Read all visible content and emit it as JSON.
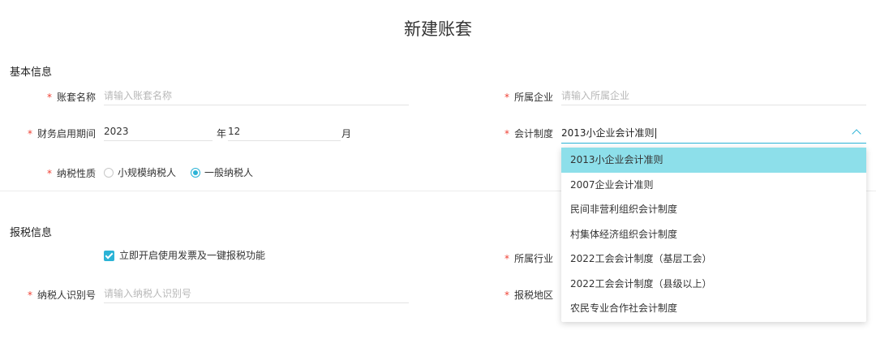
{
  "title": "新建账套",
  "basic": {
    "section": "基本信息",
    "name_label": "账套名称",
    "name_placeholder": "请输入账套名称",
    "company_label": "所属企业",
    "company_placeholder": "请输入所属企业",
    "period_label": "财务启用期间",
    "year_value": "2023",
    "year_unit": "年",
    "month_value": "12",
    "month_unit": "月",
    "accounting_label": "会计制度",
    "accounting_value": "2013小企业会计准则",
    "tax_label": "纳税性质",
    "tax_options": [
      "小规模纳税人",
      "一般纳税人"
    ]
  },
  "tax_report": {
    "section": "报税信息",
    "enable_label": "立即开启使用发票及一键报税功能",
    "industry_label": "所属行业",
    "taxpayer_id_label": "纳税人识别号",
    "taxpayer_id_placeholder": "请输入纳税人识别号",
    "region_label": "报税地区"
  },
  "required_mark": "*",
  "dropdown_options": [
    "2013小企业会计准则",
    "2007企业会计准则",
    "民间非营利组织会计制度",
    "村集体经济组织会计制度",
    "2022工会会计制度（基层工会）",
    "2022工会会计制度（县级以上）",
    "农民专业合作社会计制度"
  ],
  "colors": {
    "accent": "#2bb3d6",
    "required": "#f04134",
    "selected_option": "#8ddfea"
  }
}
